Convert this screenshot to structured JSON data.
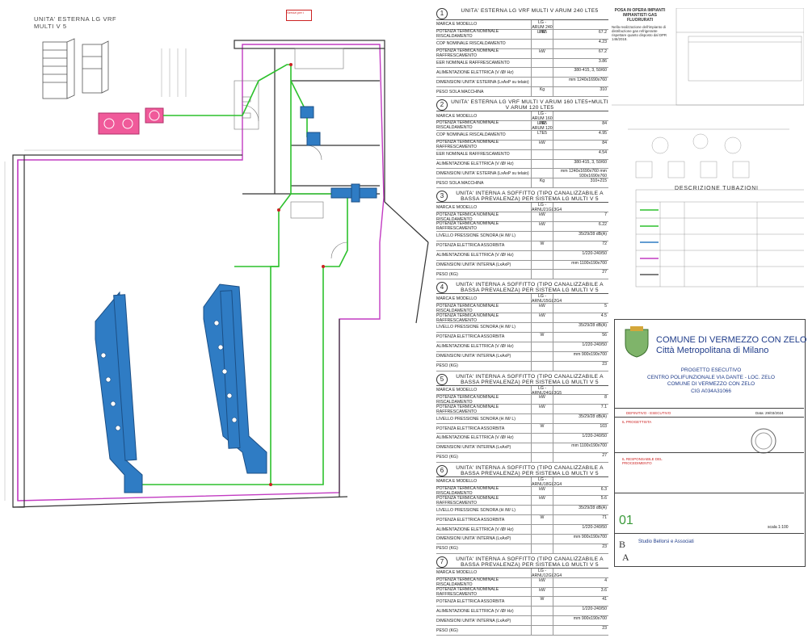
{
  "outdoor_unit_title": [
    "UNITA' ESTERNA LG VRF",
    "MULTI V 5"
  ],
  "plan_label": "Servizi per i",
  "room_labels": [
    "BIBLIOTECA",
    "SALA POLIVALENTE",
    "INGRESSO"
  ],
  "equipment": [
    {
      "num": "1",
      "title": "UNITA' ESTERNA LG VRF MULTI V ARUM 240 LTE5",
      "rows": [
        {
          "l": "MARCA E MODELLO",
          "u": "LG - ARUM 240 LTE5",
          "v": ""
        },
        {
          "l": "POTENZA TERMICA NOMINALE RISCALDAMENTO",
          "u": "kW",
          "v": "67.2"
        },
        {
          "l": "COP NOMINALE RISCALDAMENTO",
          "u": "",
          "v": "4.23"
        },
        {
          "l": "POTENZA TERMICA NOMINALE RAFFRESCAMENTO",
          "u": "kW",
          "v": "67.2"
        },
        {
          "l": "EER NOMINALE RAFFRESCAMENTO",
          "u": "",
          "v": "3.86"
        },
        {
          "l": "ALIMENTAZIONE ELETTRICA (V /Ø/ Hz)",
          "u": "",
          "v": "380-415, 3, 50/60"
        },
        {
          "l": "DIMENSIONI UNITA' ESTERNA (LxAxP su telaio)",
          "u": "",
          "v": "mm 1240x1690x760"
        },
        {
          "l": "PESO SOLA MACCHINA",
          "u": "Kg",
          "v": "310"
        }
      ]
    },
    {
      "num": "2",
      "title": "UNITA' ESTERNA LG VRF MULTI V ARUM 160 LTE5+MULTI V ARUM 120 LTE5",
      "rows": [
        {
          "l": "MARCA E MODELLO",
          "u": "LG - ARUM 160 LTE5 ARUM 120 LTE5",
          "v": ""
        },
        {
          "l": "POTENZA TERMICA NOMINALE RISCALDAMENTO",
          "u": "kW",
          "v": "84"
        },
        {
          "l": "COP NOMINALE RISCALDAMENTO",
          "u": "",
          "v": "4.95"
        },
        {
          "l": "POTENZA TERMICA NOMINALE RAFFRESCAMENTO",
          "u": "kW",
          "v": "84"
        },
        {
          "l": "EER NOMINALE RAFFRESCAMENTO",
          "u": "",
          "v": "4.54"
        },
        {
          "l": "ALIMENTAZIONE ELETTRICA (V /Ø/ Hz)",
          "u": "",
          "v": "380-415, 3, 50/60"
        },
        {
          "l": "DIMENSIONI UNITA' ESTERNA (LxAxP su telaio)",
          "u": "",
          "v": "mm 1240x1690x760 mm 930x1690x760"
        },
        {
          "l": "PESO SOLA MACCHINA",
          "u": "Kg",
          "v": "310+215"
        }
      ]
    },
    {
      "num": "3",
      "title": "UNITA' INTERNA A SOFFITTO (TIPO CANALIZZABILE A BASSA PREVALENZA) PER SISTEMA LG MULTI V 5",
      "rows": [
        {
          "l": "MARCA E MODELLO",
          "u": "LG - ARNU21GL3G4",
          "v": ""
        },
        {
          "l": "POTENZA TERMICA NOMINALE RISCALDAMENTO",
          "u": "kW",
          "v": "7"
        },
        {
          "l": "POTENZA TERMICA NOMINALE RAFFRESCAMENTO",
          "u": "kW",
          "v": "6.22"
        },
        {
          "l": "LIVELLO PRESSIONE SONORA (H /M/ L)",
          "u": "",
          "v": "35/29/28 dB(A)"
        },
        {
          "l": "POTENZA ELETTRICA ASSORBITA",
          "u": "W",
          "v": "72"
        },
        {
          "l": "ALIMENTAZIONE ELETTRICA (V /Ø/ Hz)",
          "u": "",
          "v": "1/220-240/50"
        },
        {
          "l": "DIMENSIONI UNITA' INTERNA (LxAxP)",
          "u": "",
          "v": "mm 1100x190x700"
        },
        {
          "l": "PESO (KG)",
          "u": "",
          "v": "27"
        }
      ]
    },
    {
      "num": "4",
      "title": "UNITA' INTERNA A SOFFITTO (TIPO CANALIZZABILE A BASSA PREVALENZA) PER SISTEMA LG MULTI V 5",
      "rows": [
        {
          "l": "MARCA E MODELLO",
          "u": "LG - ARNU15GL2G4",
          "v": ""
        },
        {
          "l": "POTENZA TERMICA NOMINALE RISCALDAMENTO",
          "u": "kW",
          "v": "5"
        },
        {
          "l": "POTENZA TERMICA NOMINALE RAFFRESCAMENTO",
          "u": "kW",
          "v": "4.5"
        },
        {
          "l": "LIVELLO PRESSIONE SONORA (H /M/ L)",
          "u": "",
          "v": "35/29/28 dB(A)"
        },
        {
          "l": "POTENZA ELETTRICA ASSORBITA",
          "u": "W",
          "v": "56"
        },
        {
          "l": "ALIMENTAZIONE ELETTRICA (V /Ø/ Hz)",
          "u": "",
          "v": "1/220-240/50"
        },
        {
          "l": "DIMENSIONI UNITA' INTERNA (LxAxP)",
          "u": "",
          "v": "mm 900x190x700"
        },
        {
          "l": "PESO (KG)",
          "u": "",
          "v": "23"
        }
      ]
    },
    {
      "num": "5",
      "title": "UNITA' INTERNA A SOFFITTO (TIPO CANALIZZABILE A BASSA PREVALENZA) PER SISTEMA LG MULTI V 5",
      "rows": [
        {
          "l": "MARCA E MODELLO",
          "u": "LG - ARNU24GL3G5",
          "v": ""
        },
        {
          "l": "POTENZA TERMICA NOMINALE RISCALDAMENTO",
          "u": "kW",
          "v": "8"
        },
        {
          "l": "POTENZA TERMICA NOMINALE RAFFRESCAMENTO",
          "u": "kW",
          "v": "7.1"
        },
        {
          "l": "LIVELLO PRESSIONE SONORA (H /M/ L)",
          "u": "",
          "v": "35/29/28 dB(A)"
        },
        {
          "l": "POTENZA ELETTRICA ASSORBITA",
          "u": "W",
          "v": "103"
        },
        {
          "l": "ALIMENTAZIONE ELETTRICA (V /Ø/ Hz)",
          "u": "",
          "v": "1/220-240/50"
        },
        {
          "l": "DIMENSIONI UNITA' INTERNA (LxAxP)",
          "u": "",
          "v": "mm 1100x190x700"
        },
        {
          "l": "PESO (KG)",
          "u": "",
          "v": "27"
        }
      ]
    },
    {
      "num": "6",
      "title": "UNITA' INTERNA A SOFFITTO (TIPO CANALIZZABILE A BASSA PREVALENZA) PER SISTEMA LG MULTI V 5",
      "rows": [
        {
          "l": "MARCA E MODELLO",
          "u": "LG - ARNU18GL2G4",
          "v": ""
        },
        {
          "l": "POTENZA TERMICA NOMINALE RISCALDAMENTO",
          "u": "kW",
          "v": "6.3"
        },
        {
          "l": "POTENZA TERMICA NOMINALE RAFFRESCAMENTO",
          "u": "kW",
          "v": "5.6"
        },
        {
          "l": "LIVELLO PRESSIONE SONORA (H /M/ L)",
          "u": "",
          "v": "35/29/28 dB(A)"
        },
        {
          "l": "POTENZA ELETTRICA ASSORBITA",
          "u": "W",
          "v": "71"
        },
        {
          "l": "ALIMENTAZIONE ELETTRICA (V /Ø/ Hz)",
          "u": "",
          "v": "1/220-240/50"
        },
        {
          "l": "DIMENSIONI UNITA' INTERNA (LxAxP)",
          "u": "",
          "v": "mm 900x190x700"
        },
        {
          "l": "PESO (KG)",
          "u": "",
          "v": "23"
        }
      ]
    },
    {
      "num": "7",
      "title": "UNITA' INTERNA A SOFFITTO (TIPO CANALIZZABILE A BASSA PREVALENZA) PER SISTEMA LG MULTI V 5",
      "rows": [
        {
          "l": "MARCA E MODELLO",
          "u": "LG - ARNU12GL2G4",
          "v": ""
        },
        {
          "l": "POTENZA TERMICA NOMINALE RISCALDAMENTO",
          "u": "kW",
          "v": "4"
        },
        {
          "l": "POTENZA TERMICA NOMINALE RAFFRESCAMENTO",
          "u": "kW",
          "v": "3.6"
        },
        {
          "l": "POTENZA ELETTRICA ASSORBITA",
          "u": "W",
          "v": "41"
        },
        {
          "l": "ALIMENTAZIONE ELETTRICA (V /Ø/ Hz)",
          "u": "",
          "v": "1/220-240/50"
        },
        {
          "l": "DIMENSIONI UNITA' INTERNA (LxAxP)",
          "u": "",
          "v": "mm 900x190x700"
        },
        {
          "l": "PESO (KG)",
          "u": "",
          "v": "23"
        }
      ]
    }
  ],
  "notes_title": "POSA IN OPERA IMPIANTI IMPIANTISTI GAS FLUORURATI",
  "notes_text": "Nella realizzazione dell'impianto di distribuzione gas refrigerante rispettare quanto disposto dal DPR 146/2018.",
  "tubazioni_title": "DESCRIZIONE TUBAZIONI",
  "municipality": "COMUNE DI VERMEZZO CON ZELO",
  "metro": "Città Metropolitana di Milano",
  "project_lines": [
    "PROGETTO ESECUTIVO",
    "CENTRO POLIFUNZIONALE VIA DANTE - LOC. ZELO",
    "COMUNE DI VERMEZZO CON ZELO",
    "CIG A034A31066"
  ],
  "sheet_number": "01",
  "scale": "scala 1:100",
  "studio": "Studio Bellorsi e Associati",
  "phase": "DEFINITIVO - ESECUTIVO",
  "date": "Data: 29/03/2024",
  "designer_label": "IL PROGETTISTA",
  "rup_label": "IL RESPONSABILE DEL PROCEDIMENTO",
  "colors": {
    "duct": "#2f7cc4",
    "green": "#2dc12d",
    "magenta": "#c23bc2",
    "wall": "#333333"
  }
}
